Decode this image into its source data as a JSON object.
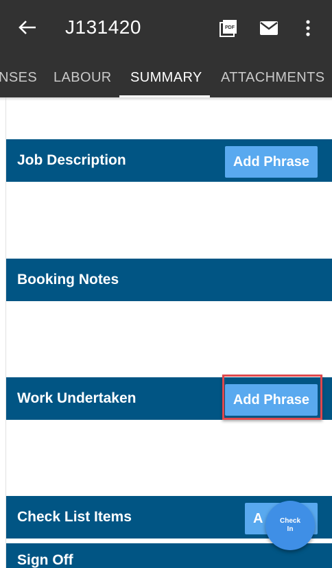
{
  "header": {
    "title": "J131420",
    "back_icon": "arrow-left-icon",
    "actions": [
      "pdf-icon",
      "mail-icon",
      "more-vertical-icon"
    ]
  },
  "tabs": [
    {
      "label": "NSES",
      "active": false
    },
    {
      "label": "LABOUR",
      "active": false
    },
    {
      "label": "SUMMARY",
      "active": true
    },
    {
      "label": "ATTACHMENTS",
      "active": false
    }
  ],
  "sections": [
    {
      "label": "Job Description",
      "button": "Add Phrase"
    },
    {
      "label": "Booking Notes"
    },
    {
      "label": "Work Undertaken",
      "button": "Add Phrase"
    },
    {
      "label": "Check List Items",
      "button": "A"
    },
    {
      "label": "Sign Off"
    }
  ],
  "fab": {
    "line1": "Check",
    "line2": "In"
  },
  "colors": {
    "appbar": "#323232",
    "section_bar": "#015584",
    "button": "#59a9ef",
    "highlight": "#e0484c",
    "fab": "#3f8fe6"
  }
}
